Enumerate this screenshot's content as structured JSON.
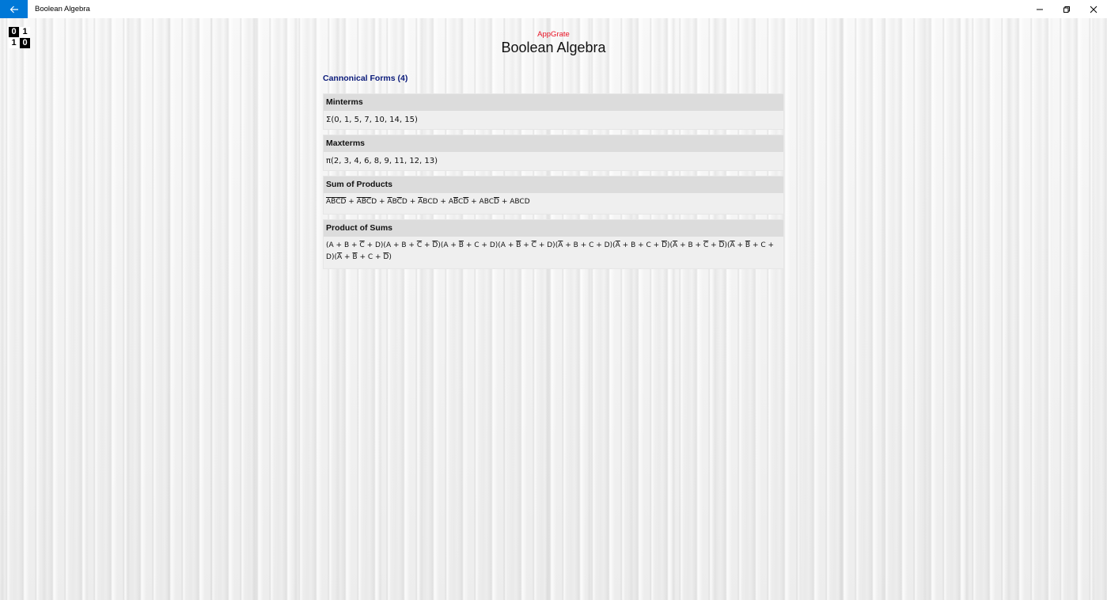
{
  "window": {
    "title": "Boolean Algebra",
    "accent": "#0078d7",
    "controls": [
      "minimize",
      "restore",
      "close"
    ]
  },
  "logo": {
    "cells": [
      "0",
      "1",
      "1",
      "0"
    ]
  },
  "header": {
    "brand": "AppGrate",
    "brand_color": "#e81123",
    "title": "Boolean Algebra"
  },
  "section": {
    "link_label": "Cannonical Forms (4)"
  },
  "cards": [
    {
      "heading": "Minterms",
      "value": "Σ(0, 1, 5, 7, 10, 14, 15)"
    },
    {
      "heading": "Maxterms",
      "value": "π(2, 3, 4, 6, 8, 9, 11, 12, 13)"
    },
    {
      "heading": "Sum of Products",
      "terms": [
        [
          {
            "v": "A",
            "bar": true
          },
          {
            "v": "B",
            "bar": true
          },
          {
            "v": "C",
            "bar": true
          },
          {
            "v": "D",
            "bar": true
          }
        ],
        [
          {
            "v": "A",
            "bar": true
          },
          {
            "v": "B",
            "bar": true
          },
          {
            "v": "C",
            "bar": true
          },
          {
            "v": "D",
            "bar": false
          }
        ],
        [
          {
            "v": "A",
            "bar": true
          },
          {
            "v": "B",
            "bar": false
          },
          {
            "v": "C",
            "bar": true
          },
          {
            "v": "D",
            "bar": false
          }
        ],
        [
          {
            "v": "A",
            "bar": true
          },
          {
            "v": "B",
            "bar": false
          },
          {
            "v": "C",
            "bar": false
          },
          {
            "v": "D",
            "bar": false
          }
        ],
        [
          {
            "v": "A",
            "bar": false
          },
          {
            "v": "B",
            "bar": true
          },
          {
            "v": "C",
            "bar": false
          },
          {
            "v": "D",
            "bar": true
          }
        ],
        [
          {
            "v": "A",
            "bar": false
          },
          {
            "v": "B",
            "bar": false
          },
          {
            "v": "C",
            "bar": false
          },
          {
            "v": "D",
            "bar": true
          }
        ],
        [
          {
            "v": "A",
            "bar": false
          },
          {
            "v": "B",
            "bar": false
          },
          {
            "v": "C",
            "bar": false
          },
          {
            "v": "D",
            "bar": false
          }
        ]
      ],
      "joiner": " + "
    },
    {
      "heading": "Product of Sums",
      "terms": [
        [
          {
            "v": "A",
            "bar": false
          },
          {
            "v": "B",
            "bar": false
          },
          {
            "v": "C",
            "bar": true
          },
          {
            "v": "D",
            "bar": false
          }
        ],
        [
          {
            "v": "A",
            "bar": false
          },
          {
            "v": "B",
            "bar": false
          },
          {
            "v": "C",
            "bar": true
          },
          {
            "v": "D",
            "bar": true
          }
        ],
        [
          {
            "v": "A",
            "bar": false
          },
          {
            "v": "B",
            "bar": true
          },
          {
            "v": "C",
            "bar": false
          },
          {
            "v": "D",
            "bar": false
          }
        ],
        [
          {
            "v": "A",
            "bar": false
          },
          {
            "v": "B",
            "bar": true
          },
          {
            "v": "C",
            "bar": true
          },
          {
            "v": "D",
            "bar": false
          }
        ],
        [
          {
            "v": "A",
            "bar": true
          },
          {
            "v": "B",
            "bar": false
          },
          {
            "v": "C",
            "bar": false
          },
          {
            "v": "D",
            "bar": false
          }
        ],
        [
          {
            "v": "A",
            "bar": true
          },
          {
            "v": "B",
            "bar": false
          },
          {
            "v": "C",
            "bar": false
          },
          {
            "v": "D",
            "bar": true
          }
        ],
        [
          {
            "v": "A",
            "bar": true
          },
          {
            "v": "B",
            "bar": false
          },
          {
            "v": "C",
            "bar": true
          },
          {
            "v": "D",
            "bar": true
          }
        ],
        [
          {
            "v": "A",
            "bar": true
          },
          {
            "v": "B",
            "bar": true
          },
          {
            "v": "C",
            "bar": false
          },
          {
            "v": "D",
            "bar": false
          }
        ],
        [
          {
            "v": "A",
            "bar": true
          },
          {
            "v": "B",
            "bar": true
          },
          {
            "v": "C",
            "bar": false
          },
          {
            "v": "D",
            "bar": true
          }
        ]
      ],
      "joiner": " + "
    }
  ]
}
